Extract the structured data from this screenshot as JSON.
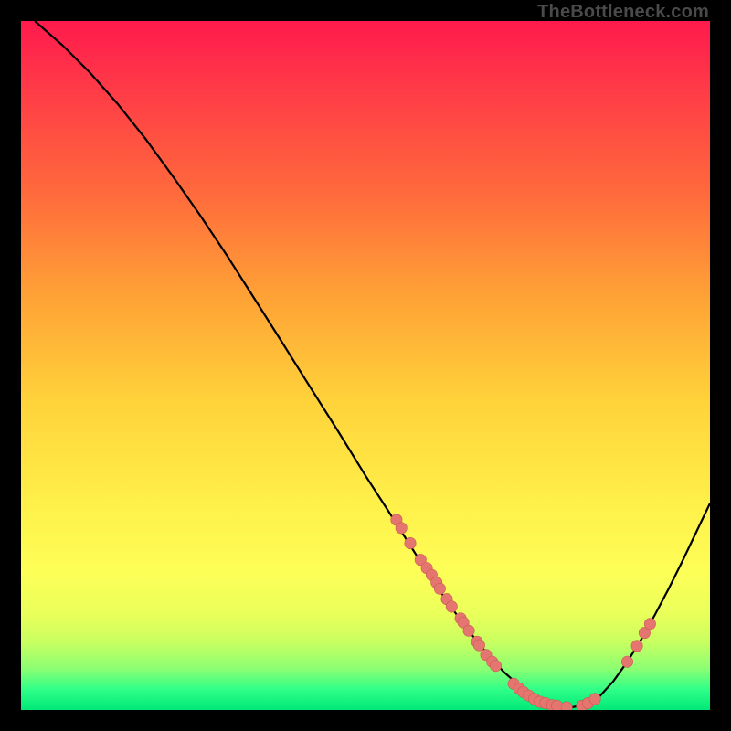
{
  "watermark": "TheBottleneck.com",
  "colors": {
    "curve_stroke": "#000000",
    "marker_fill": "#e4756f",
    "marker_stroke": "#c95a55"
  },
  "chart_data": {
    "type": "line",
    "title": "",
    "xlabel": "",
    "ylabel": "",
    "xlim": [
      0,
      100
    ],
    "ylim": [
      0,
      100
    ],
    "curve": {
      "x": [
        2,
        6,
        10,
        14,
        18,
        22,
        26,
        30,
        34,
        38,
        42,
        46,
        50,
        54,
        58,
        62,
        64,
        66,
        68,
        70,
        72,
        74,
        76,
        78,
        80,
        82,
        84,
        86,
        88,
        90,
        92,
        94,
        96,
        98,
        100
      ],
      "y": [
        100,
        96.5,
        92.5,
        88.0,
        83.0,
        77.5,
        71.8,
        65.8,
        59.5,
        53.2,
        46.8,
        40.5,
        34.0,
        27.8,
        21.5,
        15.5,
        12.8,
        10.2,
        7.8,
        5.6,
        3.8,
        2.4,
        1.4,
        0.7,
        0.4,
        0.8,
        2.0,
        4.2,
        7.0,
        10.2,
        13.8,
        17.6,
        21.6,
        25.8,
        30.0
      ]
    },
    "markers": [
      {
        "x": 54.5,
        "y": 27.6
      },
      {
        "x": 55.2,
        "y": 26.4
      },
      {
        "x": 56.5,
        "y": 24.2
      },
      {
        "x": 58.0,
        "y": 21.8
      },
      {
        "x": 58.9,
        "y": 20.6
      },
      {
        "x": 59.6,
        "y": 19.6
      },
      {
        "x": 60.3,
        "y": 18.5
      },
      {
        "x": 60.8,
        "y": 17.6
      },
      {
        "x": 61.8,
        "y": 16.1
      },
      {
        "x": 62.5,
        "y": 15.0
      },
      {
        "x": 63.8,
        "y": 13.3
      },
      {
        "x": 64.2,
        "y": 12.7
      },
      {
        "x": 65.0,
        "y": 11.5
      },
      {
        "x": 66.2,
        "y": 9.9
      },
      {
        "x": 66.5,
        "y": 9.4
      },
      {
        "x": 67.5,
        "y": 8.0
      },
      {
        "x": 68.4,
        "y": 7.0
      },
      {
        "x": 68.9,
        "y": 6.4
      },
      {
        "x": 71.5,
        "y": 3.8
      },
      {
        "x": 72.3,
        "y": 3.1
      },
      {
        "x": 72.9,
        "y": 2.6
      },
      {
        "x": 73.7,
        "y": 2.1
      },
      {
        "x": 74.5,
        "y": 1.6
      },
      {
        "x": 75.3,
        "y": 1.2
      },
      {
        "x": 76.1,
        "y": 1.0
      },
      {
        "x": 77.1,
        "y": 0.7
      },
      {
        "x": 77.8,
        "y": 0.6
      },
      {
        "x": 79.2,
        "y": 0.4
      },
      {
        "x": 81.4,
        "y": 0.6
      },
      {
        "x": 82.3,
        "y": 1.0
      },
      {
        "x": 83.3,
        "y": 1.6
      },
      {
        "x": 88.0,
        "y": 7.0
      },
      {
        "x": 89.4,
        "y": 9.3
      },
      {
        "x": 90.5,
        "y": 11.2
      },
      {
        "x": 91.3,
        "y": 12.5
      }
    ]
  }
}
